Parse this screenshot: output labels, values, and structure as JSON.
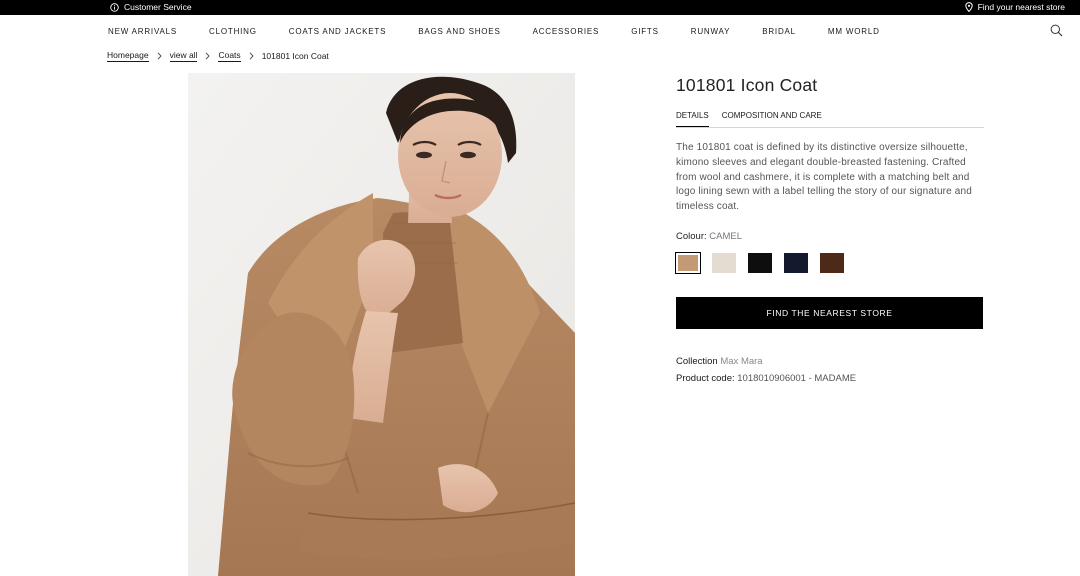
{
  "topbar": {
    "customer_service": "Customer Service",
    "find_store": "Find your nearest store"
  },
  "nav": {
    "items": [
      "NEW ARRIVALS",
      "CLOTHING",
      "COATS AND JACKETS",
      "BAGS AND SHOES",
      "ACCESSORIES",
      "GIFTS",
      "RUNWAY",
      "BRIDAL",
      "MM WORLD"
    ]
  },
  "breadcrumb": {
    "items": [
      "Homepage",
      "view all",
      "Coats"
    ],
    "current": "101801 Icon Coat"
  },
  "product": {
    "title": "101801 Icon Coat",
    "tabs": [
      "DETAILS",
      "COMPOSITION AND CARE"
    ],
    "description": "The 101801 coat is defined by its distinctive oversize silhouette, kimono sleeves and elegant double-breasted fastening. Crafted from wool and cashmere, it is complete with a matching belt and logo lining sewn with a label telling the story of our signature and timeless coat.",
    "colour_label": "Colour:",
    "colour_value": "CAMEL",
    "swatches": [
      "#c49a76",
      "#e4dcd0",
      "#0e0e0e",
      "#141a2e",
      "#4c2a17"
    ],
    "cta": "FIND THE NEAREST STORE",
    "collection_label": "Collection",
    "collection_value": "Max Mara",
    "code_label": "Product code:",
    "code_value": "1018010906001 - MADAME"
  }
}
